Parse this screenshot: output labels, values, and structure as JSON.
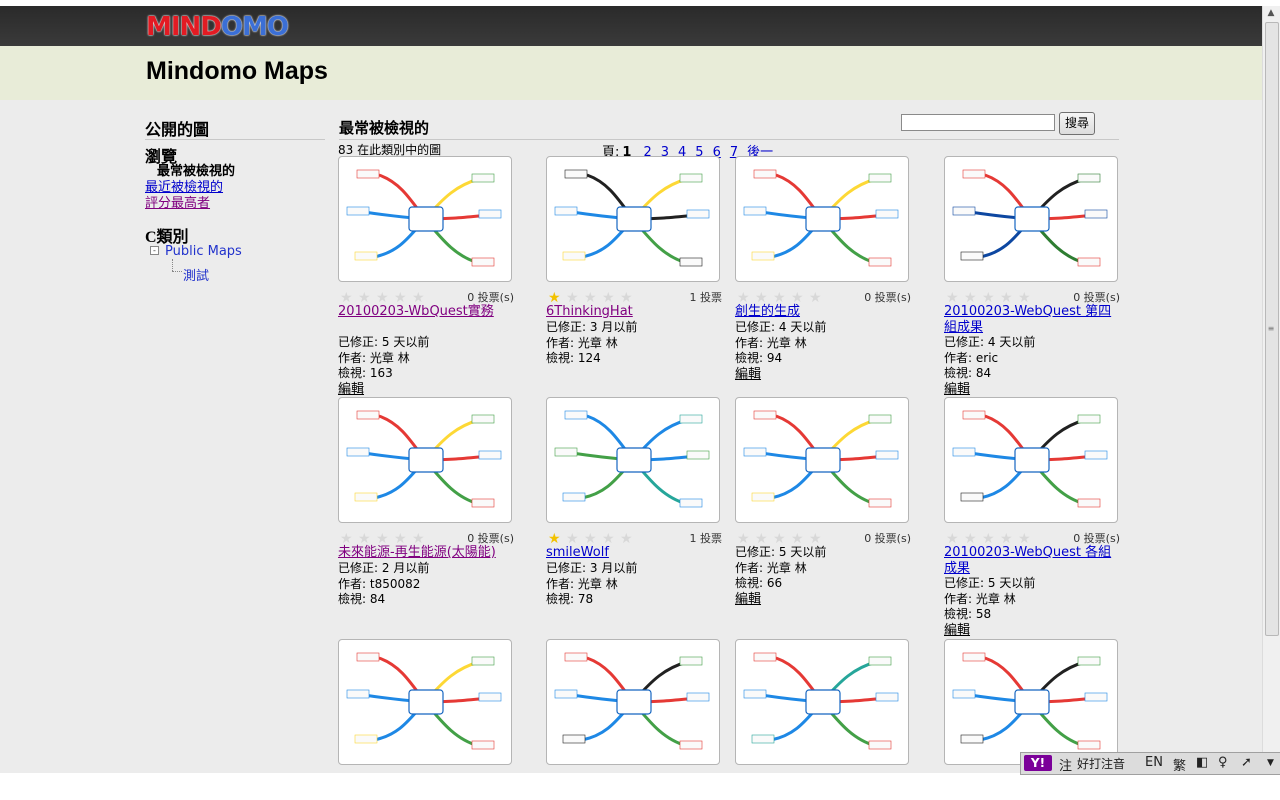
{
  "header": {
    "logo_part1": "MIND",
    "logo_part2": "OMO",
    "page_title": "Mindomo Maps"
  },
  "sidebar": {
    "public_title": "公開的圖",
    "browse_title": "瀏覽",
    "browse_current": "最常被檢視的",
    "browse_links": [
      "最近被檢視的",
      "評分最高者"
    ],
    "category_title": "C類別",
    "tree_expander": "-",
    "tree_root": "Public Maps",
    "tree_child": "測試"
  },
  "content": {
    "title": "最常被檢視的",
    "search_placeholder": "",
    "search_button": "搜尋",
    "count_text": "83 在此類別中的圖",
    "pager_label": "頁:",
    "pager_current": "1",
    "pager_pages": [
      "2",
      "3",
      "4",
      "5",
      "6",
      "7"
    ],
    "pager_next": "後一"
  },
  "labels": {
    "modified": "已修正:",
    "author": "作者:",
    "views": "檢視:",
    "edit": "編輯"
  },
  "cards": [
    {
      "title": "20100203-WbQuest實務",
      "votes": "0 投票(s)",
      "rating": 0,
      "modified": "5 天以前",
      "author": "光章 林",
      "views": "163",
      "editable": true,
      "visited": true
    },
    {
      "title": "6ThinkingHat",
      "votes": "1 投票",
      "rating": 1,
      "modified": "3 月以前",
      "author": "光章 林",
      "views": "124",
      "editable": false,
      "visited": true
    },
    {
      "title": "創生的生成",
      "votes": "0 投票(s)",
      "rating": 0,
      "modified": "4 天以前",
      "author": "光章 林",
      "views": "94",
      "editable": true,
      "visited": false
    },
    {
      "title": "20100203-WebQuest 第四組成果",
      "votes": "0 投票(s)",
      "rating": 0,
      "modified": "4 天以前",
      "author": "eric",
      "views": "84",
      "editable": true,
      "visited": false
    },
    {
      "title": "未來能源-再生能源(太陽能)",
      "votes": "0 投票(s)",
      "rating": 0,
      "modified": "2 月以前",
      "author": "t850082",
      "views": "84",
      "editable": false,
      "visited": true
    },
    {
      "title": "smileWolf",
      "votes": "1 投票",
      "rating": 1,
      "modified": "3 月以前",
      "author": "光章 林",
      "views": "78",
      "editable": false,
      "visited": false
    },
    {
      "title": "",
      "votes": "0 投票(s)",
      "rating": 0,
      "modified": "5 天以前",
      "author": "光章 林",
      "views": "66",
      "editable": true,
      "visited": false
    },
    {
      "title": "20100203-WebQuest 各組成果",
      "votes": "0 投票(s)",
      "rating": 0,
      "modified": "5 天以前",
      "author": "光章 林",
      "views": "58",
      "editable": true,
      "visited": false
    },
    {
      "title": "",
      "votes": "",
      "rating": 0,
      "modified": "",
      "author": "",
      "views": "",
      "editable": false,
      "visited": false
    },
    {
      "title": "",
      "votes": "",
      "rating": 0,
      "modified": "",
      "author": "",
      "views": "",
      "editable": false,
      "visited": false
    },
    {
      "title": "",
      "votes": "",
      "rating": 0,
      "modified": "",
      "author": "",
      "views": "",
      "editable": false,
      "visited": false
    },
    {
      "title": "",
      "votes": "",
      "rating": 0,
      "modified": "",
      "author": "",
      "views": "",
      "editable": false,
      "visited": false
    }
  ],
  "ime_bar": {
    "logo": "Y!",
    "mode": "注",
    "name": "好打注音",
    "lang": "EN",
    "charset": "繁"
  },
  "colors": {
    "header_dark": "#2f2f2f",
    "title_band": "#e8ecd8",
    "page_bg": "#ececec",
    "link": "#0000cc",
    "visited_link": "#800080",
    "star_on": "#f2c200"
  }
}
